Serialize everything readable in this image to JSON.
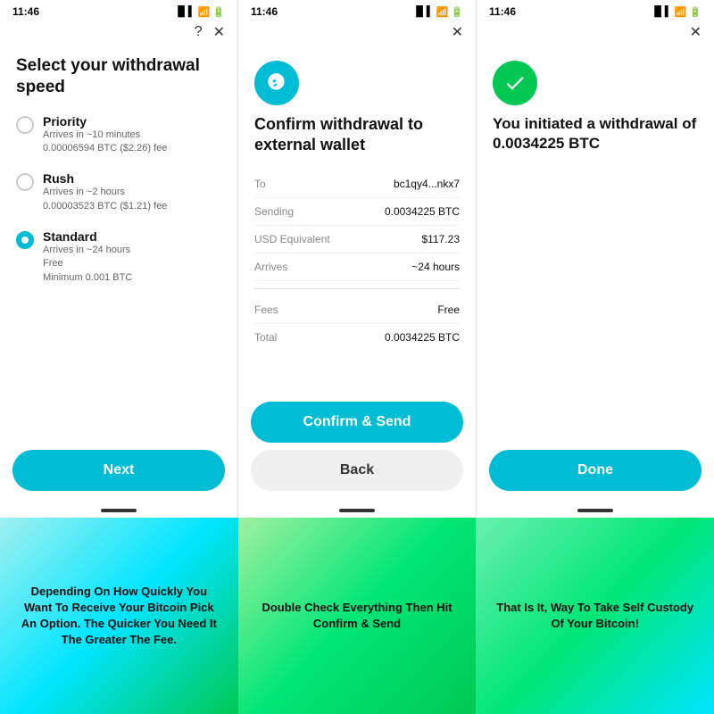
{
  "screens": [
    {
      "id": "speed-select",
      "status_time": "11:46",
      "has_question": true,
      "has_close": true,
      "title": "Select your withdrawal speed",
      "options": [
        {
          "id": "priority",
          "name": "Priority",
          "desc": "Arrives in ~10 minutes\n0.00006594 BTC ($2.26) fee",
          "selected": false
        },
        {
          "id": "rush",
          "name": "Rush",
          "desc": "Arrives in ~2 hours\n0.00003523 BTC ($1.21) fee",
          "selected": false
        },
        {
          "id": "standard",
          "name": "Standard",
          "desc": "Arrives in ~24 hours\nFree\nMinimum 0.001 BTC",
          "selected": true
        }
      ],
      "button": "Next"
    },
    {
      "id": "confirm",
      "status_time": "11:46",
      "has_close": true,
      "icon": "bitcoin",
      "title": "Confirm withdrawal to external wallet",
      "details": [
        {
          "label": "To",
          "value": "bc1qy4...nkx7"
        },
        {
          "label": "Sending",
          "value": "0.0034225 BTC"
        },
        {
          "label": "USD Equivalent",
          "value": "$117.23"
        },
        {
          "label": "Arrives",
          "value": "~24 hours"
        }
      ],
      "fee_rows": [
        {
          "label": "Fees",
          "value": "Free"
        },
        {
          "label": "Total",
          "value": "0.0034225 BTC"
        }
      ],
      "primary_button": "Confirm & Send",
      "secondary_button": "Back"
    },
    {
      "id": "success",
      "status_time": "11:46",
      "has_close": true,
      "icon": "check",
      "title": "You initiated a withdrawal of 0.0034225 BTC",
      "button": "Done"
    }
  ],
  "captions": [
    "Depending On How Quickly You Want To Receive Your Bitcoin Pick An Option. The Quicker You Need It The Greater The Fee.",
    "Double Check Everything Then Hit Confirm & Send",
    "That Is It, Way To Take Self Custody Of Your Bitcoin!"
  ]
}
